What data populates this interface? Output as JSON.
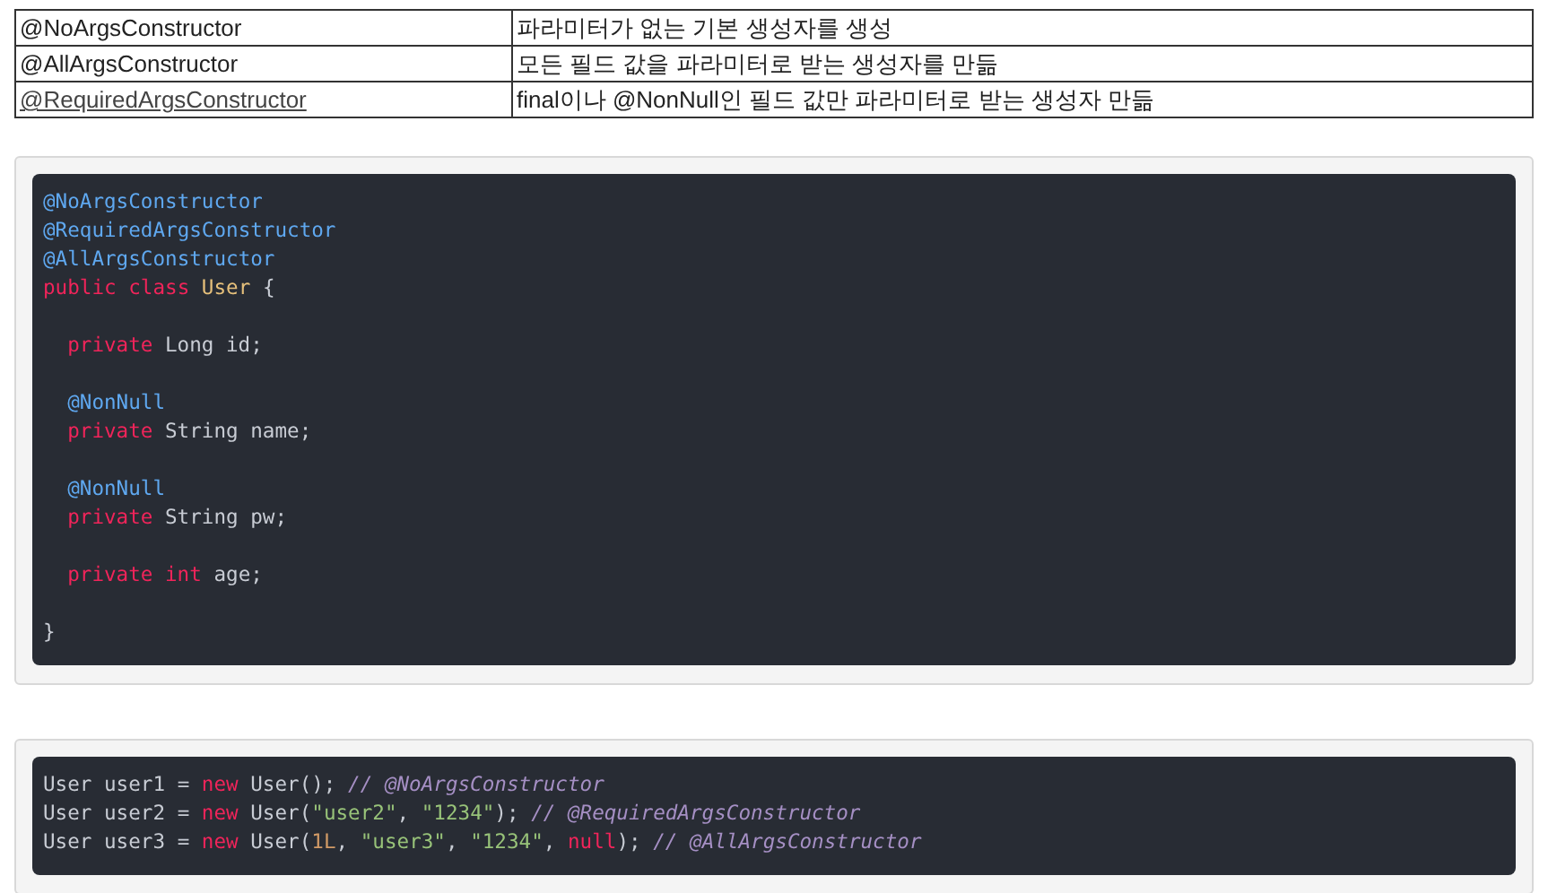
{
  "table": {
    "rows": [
      {
        "cells": [
          {
            "text": "@NoArgsConstructor",
            "kind": "plain"
          },
          {
            "text": "파라미터가 없는 기본 생성자를 생성",
            "kind": "plain"
          }
        ]
      },
      {
        "cells": [
          {
            "text": "@AllArgsConstructor",
            "kind": "plain"
          },
          {
            "text": "모든 필드 값을 파라미터로 받는 생성자를 만듦",
            "kind": "plain"
          }
        ]
      },
      {
        "cells": [
          {
            "text": "@RequiredArgsConstructor",
            "kind": "link"
          },
          {
            "text": "final이나 @NonNull인 필드 값만 파라미터로 받는 생성자 만듦",
            "kind": "plain"
          }
        ]
      }
    ]
  },
  "code_blocks": [
    {
      "lines": [
        {
          "kind": "code",
          "indented": false,
          "tokens": [
            {
              "text": "@NoArgsConstructor",
              "kind": "annotation"
            }
          ]
        },
        {
          "kind": "code",
          "indented": false,
          "tokens": [
            {
              "text": "@RequiredArgsConstructor",
              "kind": "annotation"
            }
          ]
        },
        {
          "kind": "code",
          "indented": false,
          "tokens": [
            {
              "text": "@AllArgsConstructor",
              "kind": "annotation"
            }
          ]
        },
        {
          "kind": "code",
          "indented": false,
          "tokens": [
            {
              "text": "public class",
              "kind": "keyword"
            },
            {
              "text": " User",
              "kind": "classname"
            },
            {
              "text": " {",
              "kind": "plain"
            }
          ]
        },
        {
          "kind": "blank"
        },
        {
          "kind": "code",
          "indented": true,
          "tokens": [
            {
              "text": "private",
              "kind": "keyword"
            },
            {
              "text": " Long id;",
              "kind": "plain"
            }
          ]
        },
        {
          "kind": "blank"
        },
        {
          "kind": "code",
          "indented": true,
          "tokens": [
            {
              "text": "@NonNull",
              "kind": "annotation"
            }
          ]
        },
        {
          "kind": "code",
          "indented": true,
          "tokens": [
            {
              "text": "private",
              "kind": "keyword"
            },
            {
              "text": " String name;",
              "kind": "plain"
            }
          ]
        },
        {
          "kind": "blank"
        },
        {
          "kind": "code",
          "indented": true,
          "tokens": [
            {
              "text": "@NonNull",
              "kind": "annotation"
            }
          ]
        },
        {
          "kind": "code",
          "indented": true,
          "tokens": [
            {
              "text": "private",
              "kind": "keyword"
            },
            {
              "text": " String pw;",
              "kind": "plain"
            }
          ]
        },
        {
          "kind": "blank"
        },
        {
          "kind": "code",
          "indented": true,
          "tokens": [
            {
              "text": "private",
              "kind": "keyword"
            },
            {
              "text": " int",
              "kind": "keyword"
            },
            {
              "text": " age;",
              "kind": "plain"
            }
          ]
        },
        {
          "kind": "blank"
        },
        {
          "kind": "code",
          "indented": false,
          "tokens": [
            {
              "text": "}",
              "kind": "plain"
            }
          ]
        }
      ]
    },
    {
      "lines": [
        {
          "kind": "code",
          "indented": false,
          "tokens": [
            {
              "text": "User user1 = ",
              "kind": "plain"
            },
            {
              "text": "new",
              "kind": "keyword"
            },
            {
              "text": " User(); ",
              "kind": "plain"
            },
            {
              "text": "// @NoArgsConstructor",
              "kind": "comment"
            }
          ]
        },
        {
          "kind": "code",
          "indented": false,
          "tokens": [
            {
              "text": "User user2 = ",
              "kind": "plain"
            },
            {
              "text": "new",
              "kind": "keyword"
            },
            {
              "text": " User(",
              "kind": "plain"
            },
            {
              "text": "\"user2\"",
              "kind": "string"
            },
            {
              "text": ", ",
              "kind": "plain"
            },
            {
              "text": "\"1234\"",
              "kind": "string"
            },
            {
              "text": "); ",
              "kind": "plain"
            },
            {
              "text": "// @RequiredArgsConstructor",
              "kind": "comment"
            }
          ]
        },
        {
          "kind": "code",
          "indented": false,
          "tokens": [
            {
              "text": "User user3 = ",
              "kind": "plain"
            },
            {
              "text": "new",
              "kind": "keyword"
            },
            {
              "text": " User(",
              "kind": "plain"
            },
            {
              "text": "1L",
              "kind": "number"
            },
            {
              "text": ", ",
              "kind": "plain"
            },
            {
              "text": "\"user3\"",
              "kind": "string"
            },
            {
              "text": ", ",
              "kind": "plain"
            },
            {
              "text": "\"1234\"",
              "kind": "string"
            },
            {
              "text": ", ",
              "kind": "plain"
            },
            {
              "text": "null",
              "kind": "keyword"
            },
            {
              "text": "); ",
              "kind": "plain"
            },
            {
              "text": "// @AllArgsConstructor",
              "kind": "comment"
            }
          ]
        }
      ]
    }
  ]
}
